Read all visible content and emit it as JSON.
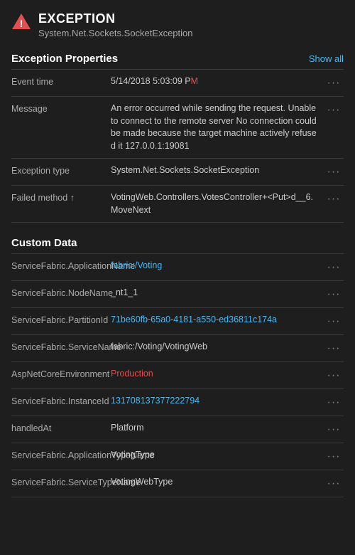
{
  "header": {
    "title": "EXCEPTION",
    "subtitle": "System.Net.Sockets.SocketException",
    "icon": "warning-triangle"
  },
  "properties_section": {
    "title": "Exception Properties",
    "show_all_label": "Show all",
    "rows": [
      {
        "key": "Event time",
        "value": "5/14/2018 5:03:09 PM",
        "highlight_part": "M",
        "has_link": false
      },
      {
        "key": "Message",
        "value": "An error occurred while sending the request. Unable to connect to the remote server No connection could be made because the target machine actively refused it 127.0.0.1:19081",
        "has_link": false
      },
      {
        "key": "Exception type",
        "value": "System.Net.Sockets.SocketException",
        "has_link": false
      },
      {
        "key": "Failed method",
        "value": "VotingWeb.Controllers.VotesController+<Put>d__6.MoveNext",
        "has_link": false
      }
    ]
  },
  "custom_section": {
    "title": "Custom Data",
    "rows": [
      {
        "key": "ServiceFabric.ApplicationName",
        "value": "fabric:/Voting",
        "link_part": "fabric:/Voting",
        "has_link": true
      },
      {
        "key": "ServiceFabric.NodeName",
        "value": "_nt1_1",
        "has_link": false
      },
      {
        "key": "ServiceFabric.PartitionId",
        "value": "71be60fb-65a0-4181-a550-ed36811c174a",
        "link_value": true,
        "has_link": false
      },
      {
        "key": "ServiceFabric.ServiceName",
        "value": "fabric:/Voting/VotingWeb",
        "has_link": false
      },
      {
        "key": "AspNetCoreEnvironment",
        "value": "Production",
        "highlight_part": "Production",
        "has_link": false
      },
      {
        "key": "ServiceFabric.InstanceId",
        "value": "131708137377222794",
        "link_value": true,
        "has_link": false
      },
      {
        "key": "handledAt",
        "value": "Platform",
        "has_link": false
      },
      {
        "key": "ServiceFabric.ApplicationTypeName",
        "value": "VotingType",
        "has_link": false
      },
      {
        "key": "ServiceFabric.ServiceTypeName",
        "value": "VotingWebType",
        "has_link": false
      }
    ]
  },
  "menu_dots": "···"
}
